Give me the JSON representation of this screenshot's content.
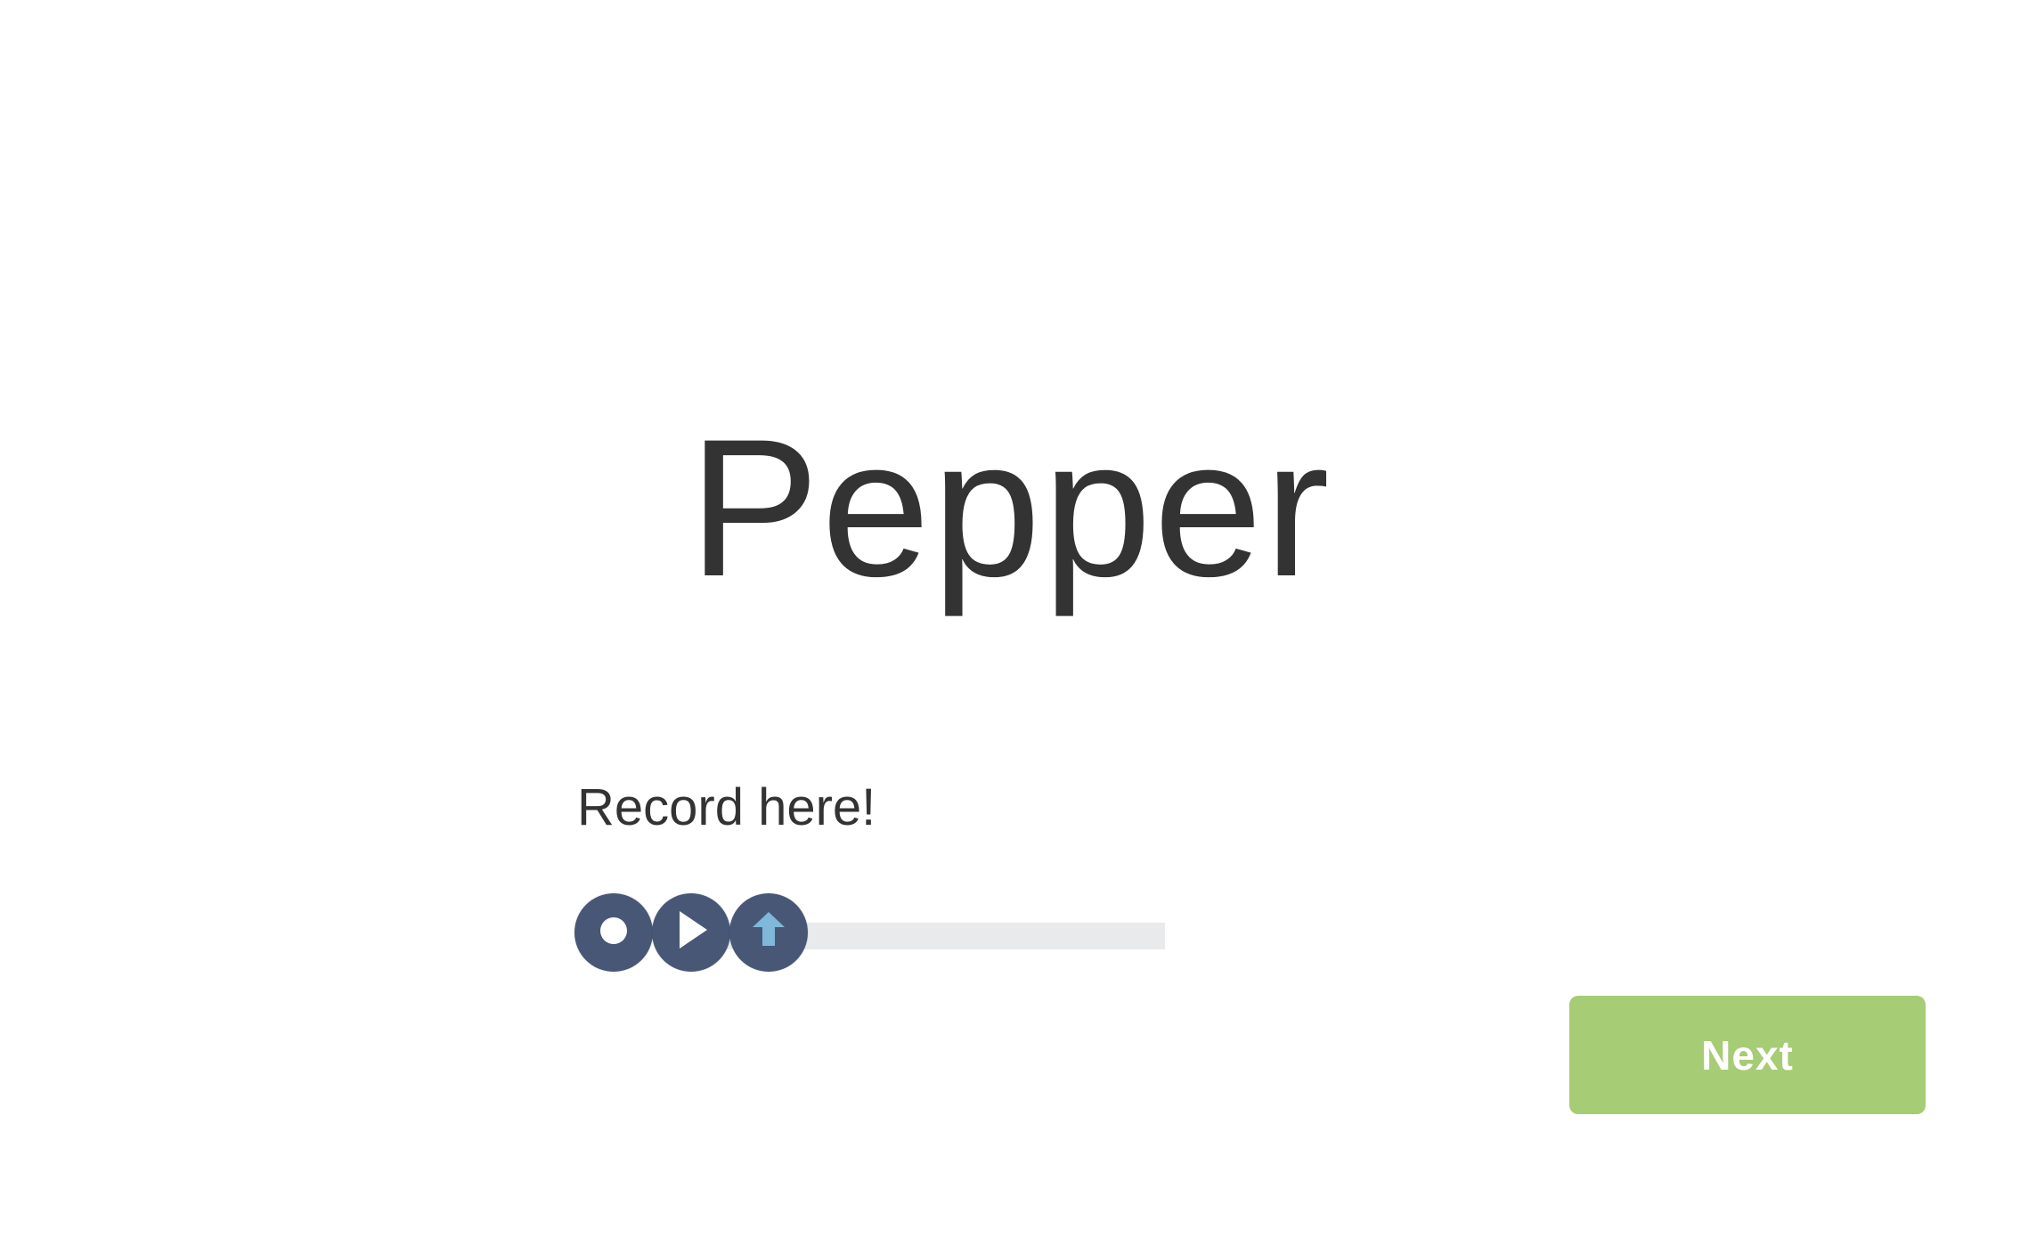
{
  "word": "Pepper",
  "record_prompt": "Record here!",
  "recorder": {
    "progress": 0,
    "buttons": [
      {
        "name": "record",
        "icon": "record-dot-icon"
      },
      {
        "name": "play",
        "icon": "play-triangle-icon"
      },
      {
        "name": "upload",
        "icon": "upload-arrow-icon"
      }
    ]
  },
  "next_label": "Next",
  "colors": {
    "text": "#333333",
    "control_bg": "#485776",
    "upload_arrow": "#7fb8d8",
    "progress_track": "#e9eaeb",
    "next_button": "#a6cc75"
  }
}
